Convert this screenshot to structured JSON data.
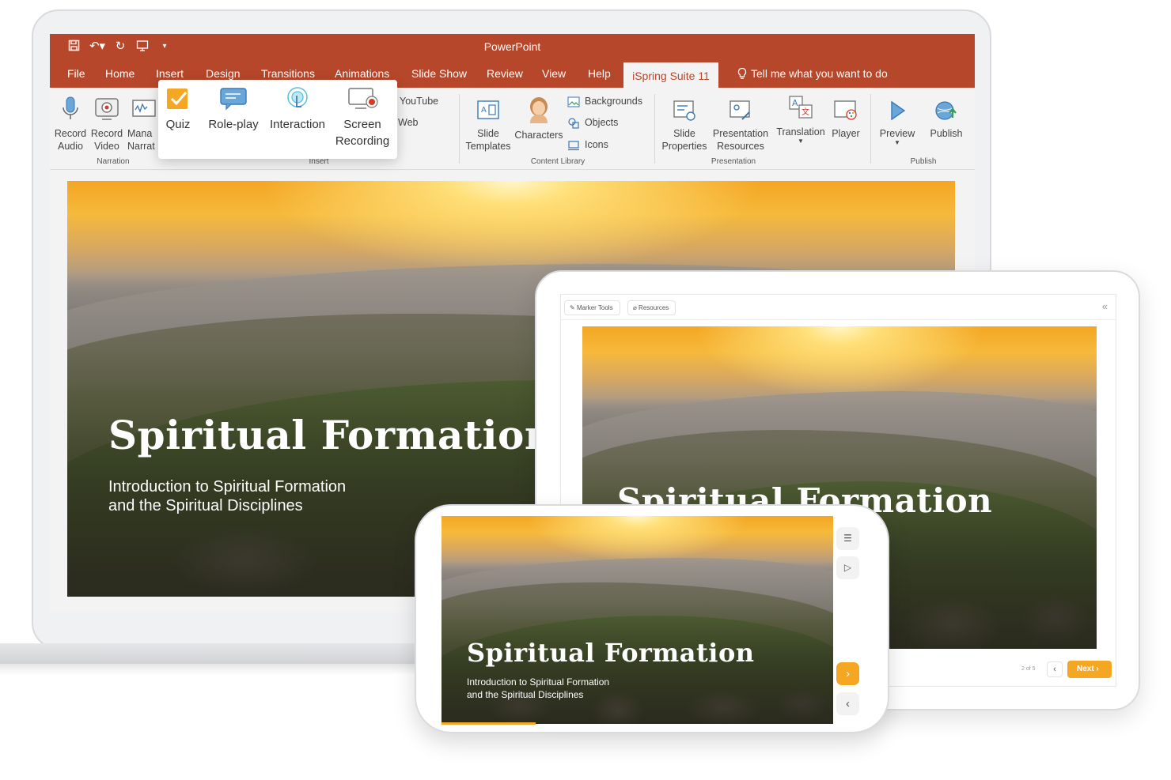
{
  "app": {
    "window_title": "PowerPoint",
    "accent_color": "#b7472a",
    "player_accent_color": "#f5a623"
  },
  "quick_access": {
    "icons": [
      "save-icon",
      "undo-icon",
      "redo-icon",
      "start-from-beginning-icon",
      "customize-icon"
    ]
  },
  "menu": {
    "items": [
      "File",
      "Home",
      "Insert",
      "Design",
      "Transitions",
      "Animations",
      "Slide Show",
      "Review",
      "View",
      "Help"
    ],
    "active": "iSpring Suite 11",
    "tell_me": "Tell me what you want to do"
  },
  "ribbon": {
    "narration": {
      "record_audio": "Record\nAudio",
      "record_video": "Record\nVideo",
      "manage_narration": "Mana\nNarrat",
      "label": "Narration"
    },
    "insert": {
      "quiz": "Quiz",
      "role_play": "Role-play",
      "interaction": "Interaction",
      "screen_recording": "Screen\nRecording",
      "youtube": "YouTube",
      "web": "Web",
      "label": "Insert"
    },
    "content_library": {
      "slide_templates": "Slide\nTemplates",
      "characters": "Characters",
      "backgrounds": "Backgrounds",
      "objects": "Objects",
      "icons": "Icons",
      "label": "Content Library"
    },
    "presentation": {
      "slide_properties": "Slide\nProperties",
      "presentation_resources": "Presentation\nResources",
      "translation": "Translation",
      "player": "Player",
      "label": "Presentation"
    },
    "publish": {
      "preview": "Preview",
      "publish": "Publish",
      "label": "Publish"
    }
  },
  "slide": {
    "title": "Spiritual Formation",
    "subtitle_line1": "Introduction to Spiritual Formation",
    "subtitle_line2": "and the Spiritual Disciplines"
  },
  "tablet_player": {
    "marker_tools": "Marker Tools",
    "resources": "Resources",
    "collapse": "«",
    "slide_counter": "2 of 5",
    "prev": "‹",
    "next": "Next ›"
  },
  "phone_player": {
    "progress": 0.24,
    "outline_icon": "list-icon",
    "play_icon": "play-icon",
    "next_icon": "chevron-right-icon",
    "prev_icon": "chevron-left-icon"
  }
}
